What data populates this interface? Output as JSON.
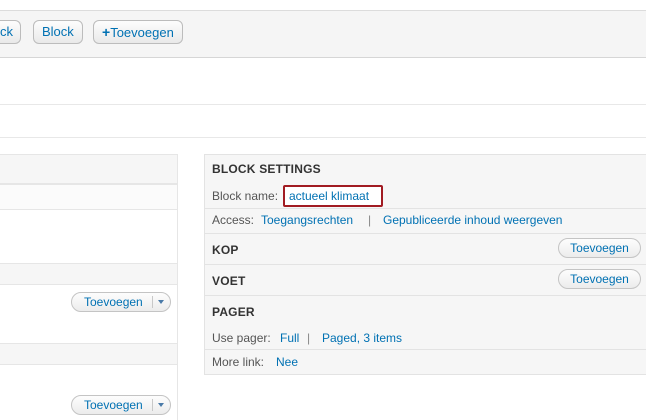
{
  "toolbar": {
    "partial_button_label": "ck",
    "block_button_label": "Block",
    "add_button_label": "Toevoegen",
    "add_button_icon": "plus-icon"
  },
  "left_column": {
    "add_dropdown_1_label": "Toevoegen",
    "add_dropdown_2_label": "Toevoegen"
  },
  "block_settings": {
    "title": "BLOCK SETTINGS",
    "block_name_label": "Block name:",
    "block_name_value": "actueel klimaat",
    "access_label": "Access:",
    "access_link_1": "Toegangsrechten",
    "access_separator": "|",
    "access_link_2": "Gepubliceerde inhoud weergeven"
  },
  "kop": {
    "title": "KOP",
    "add_label": "Toevoegen"
  },
  "voet": {
    "title": "VOET",
    "add_label": "Toevoegen"
  },
  "pager": {
    "title": "PAGER",
    "use_pager_label": "Use pager:",
    "use_pager_value": "Full",
    "separator": "|",
    "paged_value": "Paged, 3 items",
    "more_link_label": "More link:",
    "more_link_value": "Nee"
  },
  "colors": {
    "link": "#0071b3",
    "highlight_border": "#a11b22",
    "panel_background": "#f6f6f6"
  }
}
